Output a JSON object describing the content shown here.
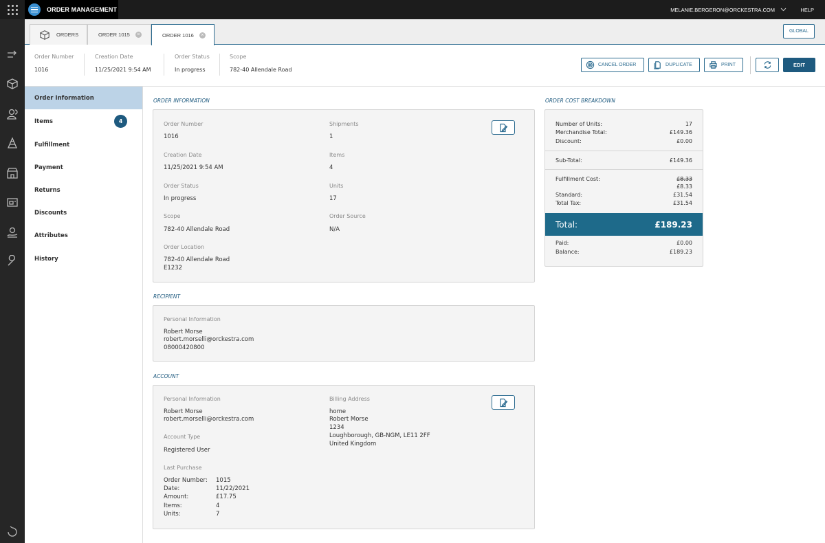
{
  "topbar": {
    "app_title": "ORDER MANAGEMENT",
    "user_email": "MELANIE.BERGERON@ORCKESTRA.COM",
    "help": "HELP"
  },
  "tabs": {
    "orders": "ORDERS",
    "order_1015": "ORDER 1015",
    "order_1016": "ORDER 1016",
    "global": "GLOBAL"
  },
  "header": {
    "order_number_label": "Order Number",
    "order_number": "1016",
    "creation_date_label": "Creation Date",
    "creation_date": "11/25/2021 9:54 AM",
    "order_status_label": "Order Status",
    "order_status": "In progress",
    "scope_label": "Scope",
    "scope": "782-40 Allendale Road",
    "cancel_order": "CANCEL ORDER",
    "duplicate": "DUPLICATE",
    "print": "PRINT",
    "edit": "EDIT"
  },
  "sidenav": {
    "items": [
      {
        "label": "Order Information"
      },
      {
        "label": "Items",
        "badge": "4"
      },
      {
        "label": "Fulfillment"
      },
      {
        "label": "Payment"
      },
      {
        "label": "Returns"
      },
      {
        "label": "Discounts"
      },
      {
        "label": "Attributes"
      },
      {
        "label": "History"
      }
    ]
  },
  "order_info": {
    "section_title": "ORDER INFORMATION",
    "order_number_label": "Order Number",
    "order_number": "1016",
    "creation_date_label": "Creation Date",
    "creation_date": "11/25/2021 9:54 AM",
    "order_status_label": "Order Status",
    "order_status": "In progress",
    "scope_label": "Scope",
    "scope": "782-40 Allendale Road",
    "order_location_label": "Order Location",
    "order_location_line1": "782-40 Allendale Road",
    "order_location_line2": "E1232",
    "shipments_label": "Shipments",
    "shipments": "1",
    "items_label": "Items",
    "items": "4",
    "units_label": "Units",
    "units": "17",
    "order_source_label": "Order Source",
    "order_source": "N/A"
  },
  "recipient": {
    "section_title": "RECIPIENT",
    "personal_info_label": "Personal Information",
    "name": "Robert Morse",
    "email": "robert.morselli@orckestra.com",
    "phone": "08000420800"
  },
  "account": {
    "section_title": "ACCOUNT",
    "personal_info_label": "Personal Information",
    "name": "Robert Morse",
    "email": "robert.morselli@orckestra.com",
    "account_type_label": "Account Type",
    "account_type": "Registered User",
    "last_purchase_label": "Last Purchase",
    "last_purchase": [
      {
        "k": "Order Number:",
        "v": "1015"
      },
      {
        "k": "Date:",
        "v": "11/22/2021"
      },
      {
        "k": "Amount:",
        "v": "£17.75"
      },
      {
        "k": "Items:",
        "v": "4"
      },
      {
        "k": "Units:",
        "v": "7"
      }
    ],
    "billing_address_label": "Billing Address",
    "billing_line1": "home",
    "billing_line2": "Robert Morse",
    "billing_line3": "1234",
    "billing_line4": "Loughborough, GB-NGM, LE11 2FF",
    "billing_line5": "United Kingdom"
  },
  "cost": {
    "section_title": "ORDER COST BREAKDOWN",
    "units_label": "Number of Units:",
    "units": "17",
    "merch_label": "Merchandise Total:",
    "merch": "£149.36",
    "discount_label": "Discount:",
    "discount": "£0.00",
    "subtotal_label": "Sub-Total:",
    "subtotal": "£149.36",
    "fulfillment_label": "Fulfillment Cost:",
    "fulfillment_old": "£8.33",
    "fulfillment": "£8.33",
    "standard_label": "Standard:",
    "standard": "£31.54",
    "tax_label": "Total Tax:",
    "tax": "£31.54",
    "total_label": "Total:",
    "total": "£189.23",
    "paid_label": "Paid:",
    "paid": "£0.00",
    "balance_label": "Balance:",
    "balance": "£189.23"
  }
}
